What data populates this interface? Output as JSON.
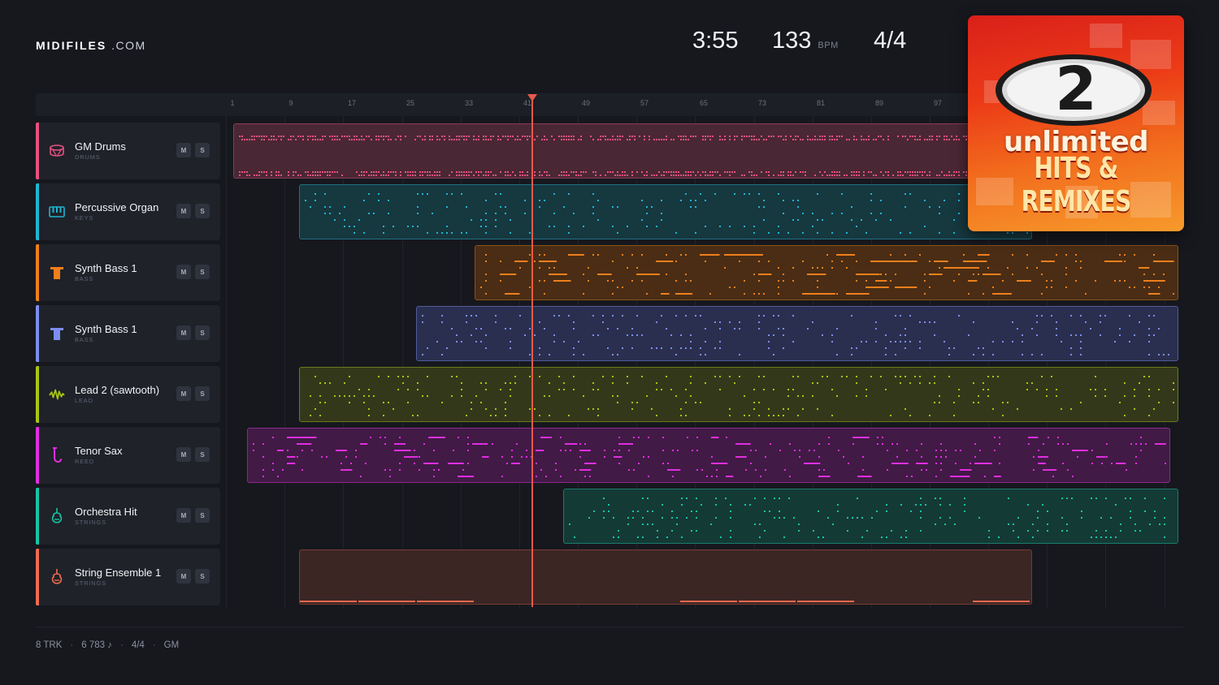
{
  "brand": {
    "name": "MIDIFILES",
    "suffix": ".COM"
  },
  "header": {
    "duration": "3:55",
    "bpm": "133",
    "bpm_unit": "BPM",
    "time_signature": "4/4"
  },
  "ruler": {
    "ticks": [
      "1",
      "9",
      "17",
      "25",
      "33",
      "41",
      "49",
      "57",
      "65",
      "73",
      "81",
      "89",
      "97"
    ]
  },
  "tracks": [
    {
      "name": "GM Drums",
      "category": "DRUMS",
      "color": "#e8517f",
      "icon": "drum-icon",
      "mute": "M",
      "solo": "S"
    },
    {
      "name": "Percussive Organ",
      "category": "KEYS",
      "color": "#1fb5d3",
      "icon": "keys-icon",
      "mute": "M",
      "solo": "S"
    },
    {
      "name": "Synth Bass 1",
      "category": "BASS",
      "color": "#f07f1d",
      "icon": "bass-icon",
      "mute": "M",
      "solo": "S"
    },
    {
      "name": "Synth Bass 1",
      "category": "BASS",
      "color": "#7d8ef0",
      "icon": "bass-icon",
      "mute": "M",
      "solo": "S"
    },
    {
      "name": "Lead 2 (sawtooth)",
      "category": "LEAD",
      "color": "#a7c414",
      "icon": "wave-icon",
      "mute": "M",
      "solo": "S"
    },
    {
      "name": "Tenor Sax",
      "category": "REED",
      "color": "#e02ee0",
      "icon": "sax-icon",
      "mute": "M",
      "solo": "S"
    },
    {
      "name": "Orchestra Hit",
      "category": "STRINGS",
      "color": "#18c4a4",
      "icon": "violin-icon",
      "mute": "M",
      "solo": "S"
    },
    {
      "name": "String Ensemble 1",
      "category": "STRINGS",
      "color": "#f06a4f",
      "icon": "violin-icon",
      "mute": "M",
      "solo": "S"
    }
  ],
  "album": {
    "logo": "2",
    "line1": "unlimited",
    "line2": "HITS & REMIXES"
  },
  "footer": {
    "tracks": "8 TRK",
    "notes": "6 783 ♪",
    "time_signature": "4/4",
    "standard": "GM"
  }
}
